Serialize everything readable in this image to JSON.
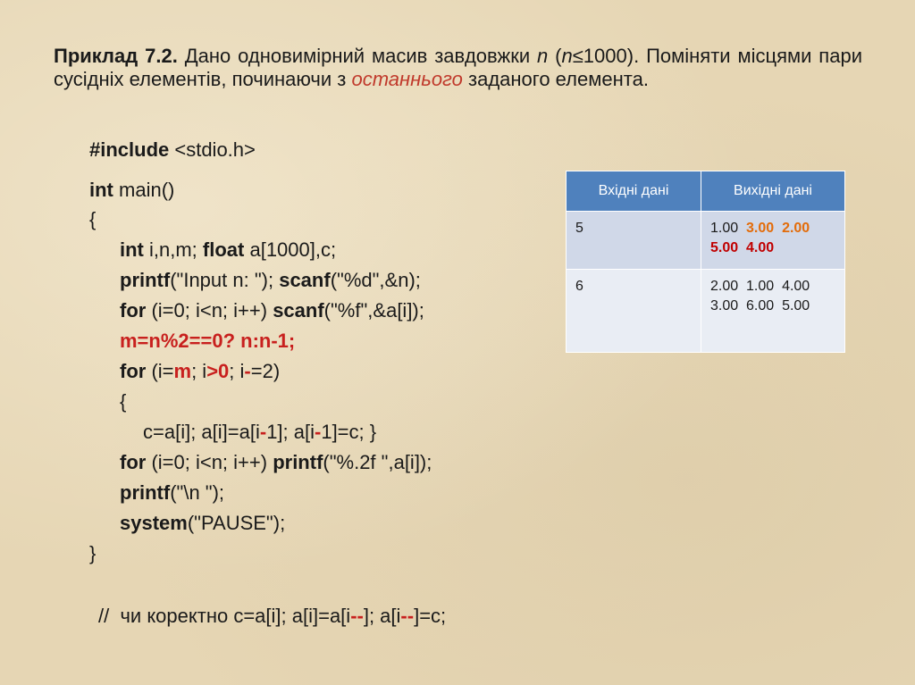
{
  "statement": {
    "title": "Приклад 7.2.",
    "text_1": " Дано одновимірний масив завдовжки ",
    "n_var": "n",
    "paren": " (",
    "n_cond": "n",
    "cond_rest": "≤1000). Поміняти місцями пари сусідніх елементів, починаючи з ",
    "highlight": "останнього",
    "text_2": " заданого елемента."
  },
  "code": {
    "include_kw": "#include",
    "include_rest": " <stdio.h>",
    "line_main_kw": "int",
    "line_main_rest": " main()",
    "open_brace": "{",
    "l3_kw1": "int",
    "l3_mid": " i,n,m; ",
    "l3_kw2": "float",
    "l3_rest": " a[1000],c;",
    "l4_kw1": "printf",
    "l4_mid": "(\"Input n: \"); ",
    "l4_kw2": "scanf",
    "l4_rest": "(\"%d\",&n);",
    "l5_kw1": "for",
    "l5_mid": " (i=0; i<n; i++) ",
    "l5_kw2": "scanf",
    "l5_rest": "(\"%f\",&a[i]);",
    "l6": "m=n%2==0? n:n-1;",
    "l7_kw": "for",
    "l7_a": " (i=",
    "l7_m": "m",
    "l7_b": "; i",
    "l7_gt": ">0",
    "l7_c": "; i",
    "l7_minus": "-",
    "l7_d": "=2)",
    "l8": "{",
    "l9_a": "c=a[i]; a[i]=a[i",
    "l9_m1": "-",
    "l9_b": "1]; a[i",
    "l9_m2": "-",
    "l9_c": "1]=c; }",
    "l10_kw1": "for",
    "l10_mid": " (i=0; i<n; i++) ",
    "l10_kw2": "printf",
    "l10_rest": "(\"%.2f \",a[i]);",
    "l11_kw": "printf",
    "l11_rest": "(\"\\n \");",
    "l12_kw": "system",
    "l12_rest": "(\"PAUSE\");",
    "close_brace": "}",
    "comment_a": "//  чи коректно c=a[i]; a[i]=a[i",
    "comment_m1": "--",
    "comment_b": "]; a[i",
    "comment_m2": "--",
    "comment_c": "]=c;"
  },
  "table": {
    "headers": [
      "Вхідні дані",
      "Вихідні дані"
    ],
    "row1": {
      "input": "5",
      "out_1": "1.00",
      "out_2": "3.00",
      "out_3": "2.00",
      "out_4": "5.00",
      "out_5": "4.00"
    },
    "row2": {
      "input": "6",
      "out_line1": "2.00  1.00  4.00",
      "out_line2": "3.00  6.00  5.00"
    }
  },
  "colors": {
    "header_bg": "#4f81bd",
    "highlight_red": "#c8201e",
    "highlight_orange": "#e36c0a"
  }
}
